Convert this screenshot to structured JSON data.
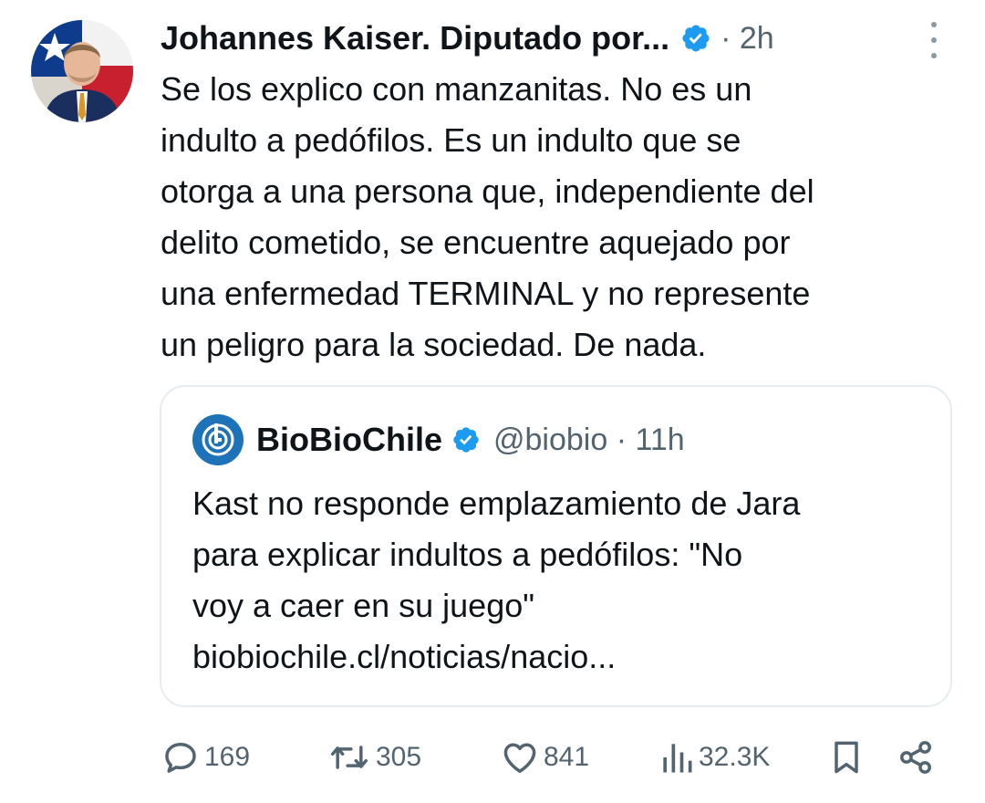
{
  "author": {
    "display_name": "Johannes Kaiser. Diputado por...",
    "time": "· 2h",
    "avatar_icon": "profile-photo",
    "verified_icon": "verified-badge-icon"
  },
  "tweet": {
    "lines": [
      "Se los explico con manzanitas. No es un",
      "indulto a pedófilos. Es un indulto que se",
      "otorga a una persona que, independiente del",
      "delito cometido, se encuentre aquejado por",
      "una enfermedad TERMINAL y no represente",
      "un peligro para la sociedad. De nada."
    ]
  },
  "quote": {
    "name": "BioBioChile",
    "handle_time": "@biobio · 11h",
    "logo_icon": "biobio-logo-icon",
    "lines": [
      "Kast no responde emplazamiento de Jara",
      "para explicar indultos a pedófilos: \"No",
      "voy a caer en su juego\"",
      "biobiochile.cl/noticias/nacio..."
    ]
  },
  "actions": {
    "replies": "169",
    "reposts": "305",
    "likes": "841",
    "views": "32.3K"
  },
  "colors": {
    "text": "#0f1419",
    "secondary": "#536471",
    "verified": "#1d9bf0",
    "border": "#e6ecf0",
    "biobio_blue": "#1e73b8"
  }
}
